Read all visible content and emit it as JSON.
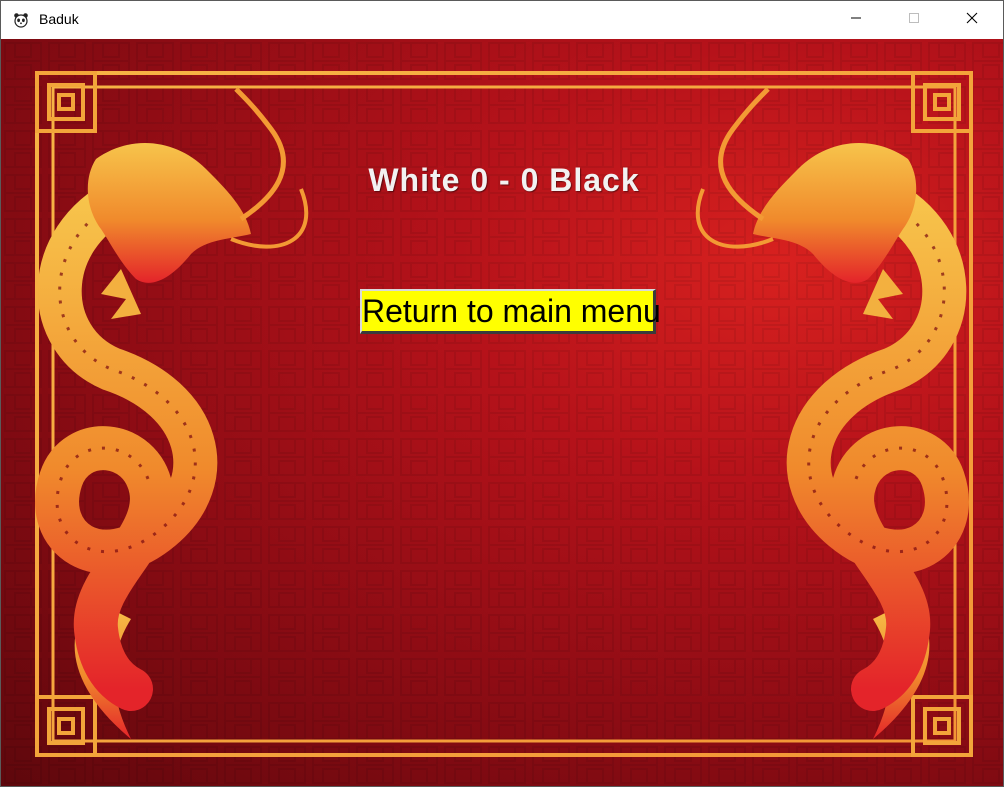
{
  "window": {
    "title": "Baduk",
    "icon": "panda-icon",
    "controls": [
      "minimize-icon",
      "maximize-icon",
      "close-icon"
    ]
  },
  "game": {
    "score_text": "White 0 - 0 Black",
    "return_button_label": "Return to main menu"
  },
  "colors": {
    "background_red": "#b5121a",
    "frame_gold": "#f2a93b",
    "dragon_gold": "#f0b23c",
    "button_yellow": "#ffff00"
  }
}
